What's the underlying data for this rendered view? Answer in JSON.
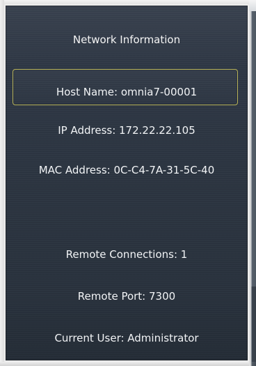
{
  "panel": {
    "title": "Network Information",
    "host_name": "Host Name: omnia7-00001",
    "ip_address": "IP Address: 172.22.22.105",
    "mac_address": "MAC Address: 0C-C4-7A-31-5C-40",
    "remote_connections": "Remote Connections: 1",
    "remote_port": "Remote Port: 7300",
    "current_user": "Current User: Administrator"
  },
  "colors": {
    "panel_background": "#2b3440",
    "panel_border": "#ededed",
    "text": "#f2f4f6",
    "host_highlight": "#b8b35a"
  }
}
